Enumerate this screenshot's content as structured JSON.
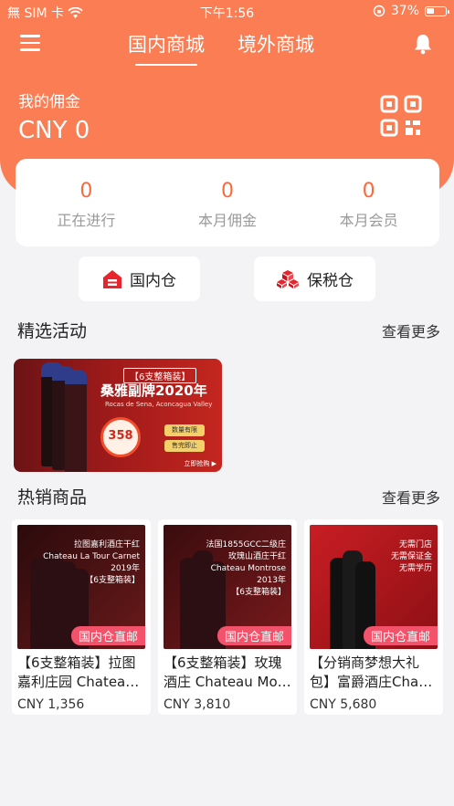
{
  "status_bar": {
    "carrier": "無 SIM 卡",
    "time": "下午1:56",
    "battery": "37%"
  },
  "header": {
    "tabs": [
      {
        "label": "国内商城",
        "active": true
      },
      {
        "label": "境外商城",
        "active": false
      }
    ],
    "commission_label": "我的佣金",
    "commission_value": "CNY 0"
  },
  "stats": [
    {
      "value": "0",
      "label": "正在进行"
    },
    {
      "value": "0",
      "label": "本月佣金"
    },
    {
      "value": "0",
      "label": "本月会员"
    }
  ],
  "warehouses": {
    "domestic": "国内仓",
    "bonded": "保税仓"
  },
  "featured": {
    "title": "精选活动",
    "more": "查看更多",
    "banner": {
      "tag": "【6支整箱装】",
      "title": "桑雅副牌2020年",
      "subtitle": "Rocas de Sena, Aconcagua Valley",
      "price": "358",
      "pill1": "数量有限",
      "pill2": "售完即止",
      "buy": "立即抢购 ▶"
    }
  },
  "hot": {
    "title": "热销商品",
    "more": "查看更多",
    "products": [
      {
        "name1": "【6支整箱装】拉图",
        "name2": "嘉利庄园 Chateau La Tour Carnet",
        "price": "CNY 1,356",
        "badge": "国内仓直邮",
        "img_title": "拉图嘉利酒庄干红\nChateau La Tour Carnet\n2019年\n【6支整箱装】"
      },
      {
        "name1": "【6支整箱装】玫瑰",
        "name2": "酒庄 Chateau Montrose",
        "price": "CNY 3,810",
        "badge": "国内仓直邮",
        "img_title": "法国1855GCC二级庄\n玫瑰山酒庄干红\nChateau Montrose\n2013年\n【6支整箱装】"
      },
      {
        "name1": "【分销商梦想大礼",
        "name2": "包】富爵酒庄Chateau",
        "price": "CNY 5,680",
        "badge": "国内仓直邮",
        "img_title": "无需门店\n无需保证金\n无需学历"
      }
    ]
  },
  "colors": {
    "brand": "#fa7d53",
    "accent": "#fa6a3c",
    "badge": "#f2536b"
  }
}
